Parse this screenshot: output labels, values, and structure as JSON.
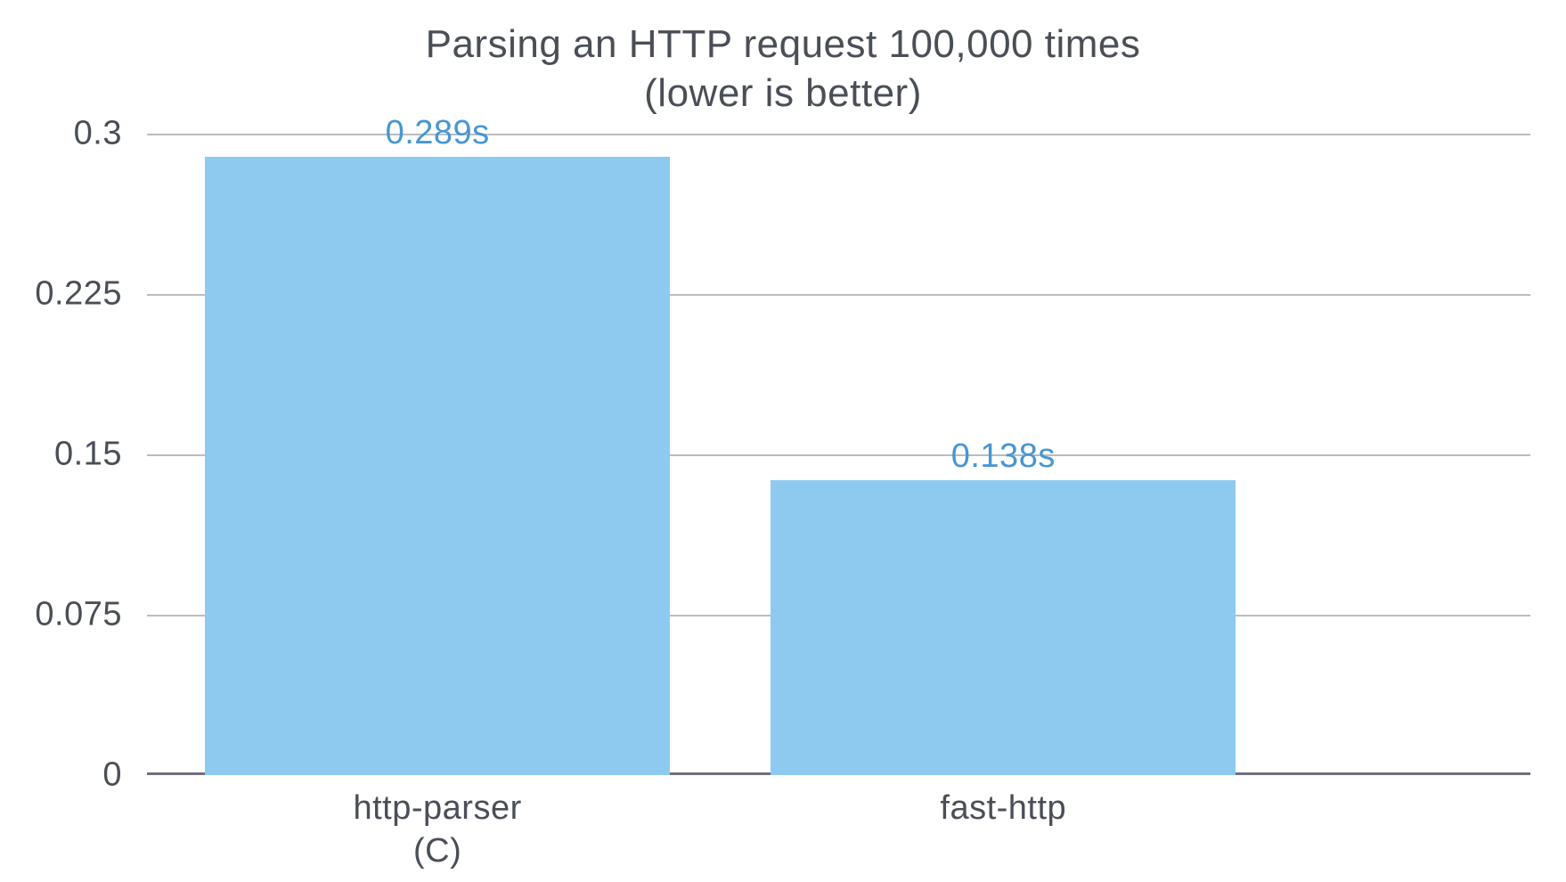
{
  "chart_data": {
    "type": "bar",
    "title": "Parsing an HTTP request 100,000 times",
    "subtitle": "(lower is better)",
    "categories": [
      "http-parser\n(C)",
      "fast-http"
    ],
    "values": [
      0.289,
      0.138
    ],
    "value_labels": [
      "0.289s",
      "0.138s"
    ],
    "ylabel": "",
    "xlabel": "",
    "ylim": [
      0,
      0.3
    ],
    "yticks": [
      0,
      0.075,
      0.15,
      0.225,
      0.3
    ],
    "ytick_labels": [
      "0",
      "0.075",
      "0.15",
      "0.225",
      "0.3"
    ],
    "bar_color": "#8ecaf0",
    "label_color": "#4796d2"
  }
}
